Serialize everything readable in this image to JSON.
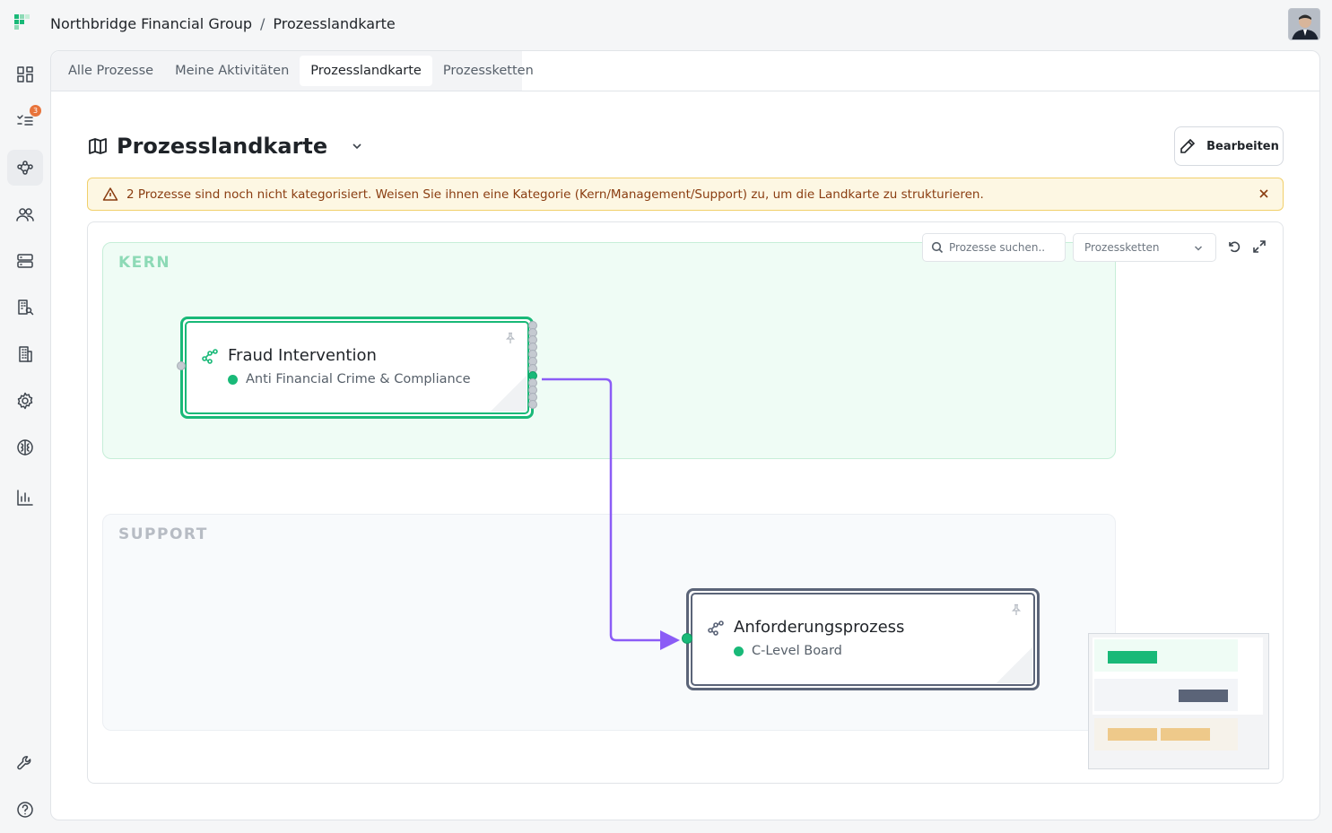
{
  "breadcrumb": {
    "org": "Northbridge Financial Group",
    "separator": "/",
    "page": "Prozesslandkarte"
  },
  "sidebar": {
    "tasks_badge": "3"
  },
  "tabs": [
    "Alle Prozesse",
    "Meine Aktivitäten",
    "Prozesslandkarte",
    "Prozessketten"
  ],
  "header": {
    "title": "Prozesslandkarte",
    "edit_label": "Bearbeiten"
  },
  "alert": {
    "text": "2 Prozesse sind noch nicht kategorisiert. Weisen Sie ihnen eine Kategorie (Kern/Management/Support) zu, um die Landkarte zu strukturieren."
  },
  "canvas": {
    "search_placeholder": "Prozesse suchen..",
    "filter_value": "Prozessketten",
    "lanes": {
      "kern": "KERN",
      "support": "SUPPORT"
    },
    "nodes": [
      {
        "title": "Fraud Intervention",
        "owner": "Anti Financial Crime & Compliance"
      },
      {
        "title": "Anforderungsprozess",
        "owner": "C-Level Board"
      }
    ]
  },
  "colors": {
    "accent_green": "#19b978",
    "edge_purple": "#8b5cf6",
    "node_gray": "#5b6478",
    "alert_text": "#8a3d11"
  }
}
